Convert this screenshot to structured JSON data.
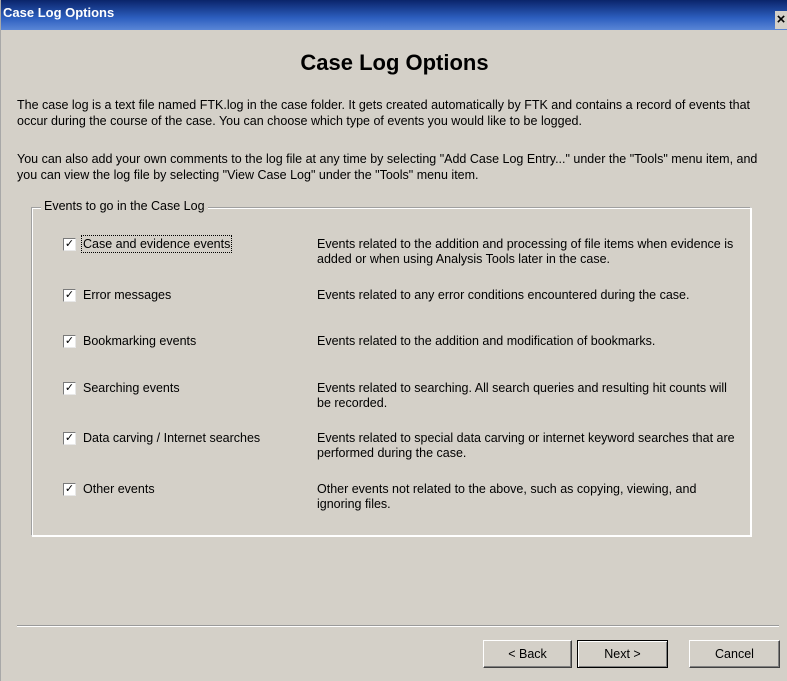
{
  "window": {
    "title": "Case Log Options",
    "close_glyph": "×"
  },
  "heading": "Case Log Options",
  "intro": {
    "paragraph1": "The case log is a text file named FTK.log in the case folder. It gets created automatically by FTK and contains a record of events that occur during the course of the case. You can choose which type of events you would like to be logged.",
    "paragraph2": "You can also add your own comments to the log file at any time by selecting \"Add Case Log Entry...\" under the \"Tools\" menu item, and you can view the log file by selecting \"View Case Log\" under the \"Tools\" menu item."
  },
  "group": {
    "legend": "Events to go in the Case Log",
    "events": [
      {
        "label": "Case and evidence events",
        "checked": true,
        "check_glyph": "✓",
        "description": "Events related to the addition and processing of file items when evidence is added or when using Analysis Tools later in the case."
      },
      {
        "label": "Error messages",
        "checked": true,
        "check_glyph": "✓",
        "description": "Events related to any error conditions encountered during the case."
      },
      {
        "label": "Bookmarking events",
        "checked": true,
        "check_glyph": "✓",
        "description": "Events related to the addition and modification of bookmarks."
      },
      {
        "label": "Searching events",
        "checked": true,
        "check_glyph": "✓",
        "description": "Events related to searching. All search queries and resulting hit counts will be recorded."
      },
      {
        "label": "Data carving / Internet searches",
        "checked": true,
        "check_glyph": "✓",
        "description": "Events related to special data carving or internet keyword searches that are performed during the case."
      },
      {
        "label": "Other events",
        "checked": true,
        "check_glyph": "✓",
        "description": "Other events not related to the above, such as copying, viewing, and ignoring files."
      }
    ]
  },
  "buttons": {
    "back": "< Back",
    "next": "Next >",
    "cancel": "Cancel"
  },
  "colors": {
    "dialog_bg": "#d4d0c8",
    "titlebar": "#0a246a"
  }
}
